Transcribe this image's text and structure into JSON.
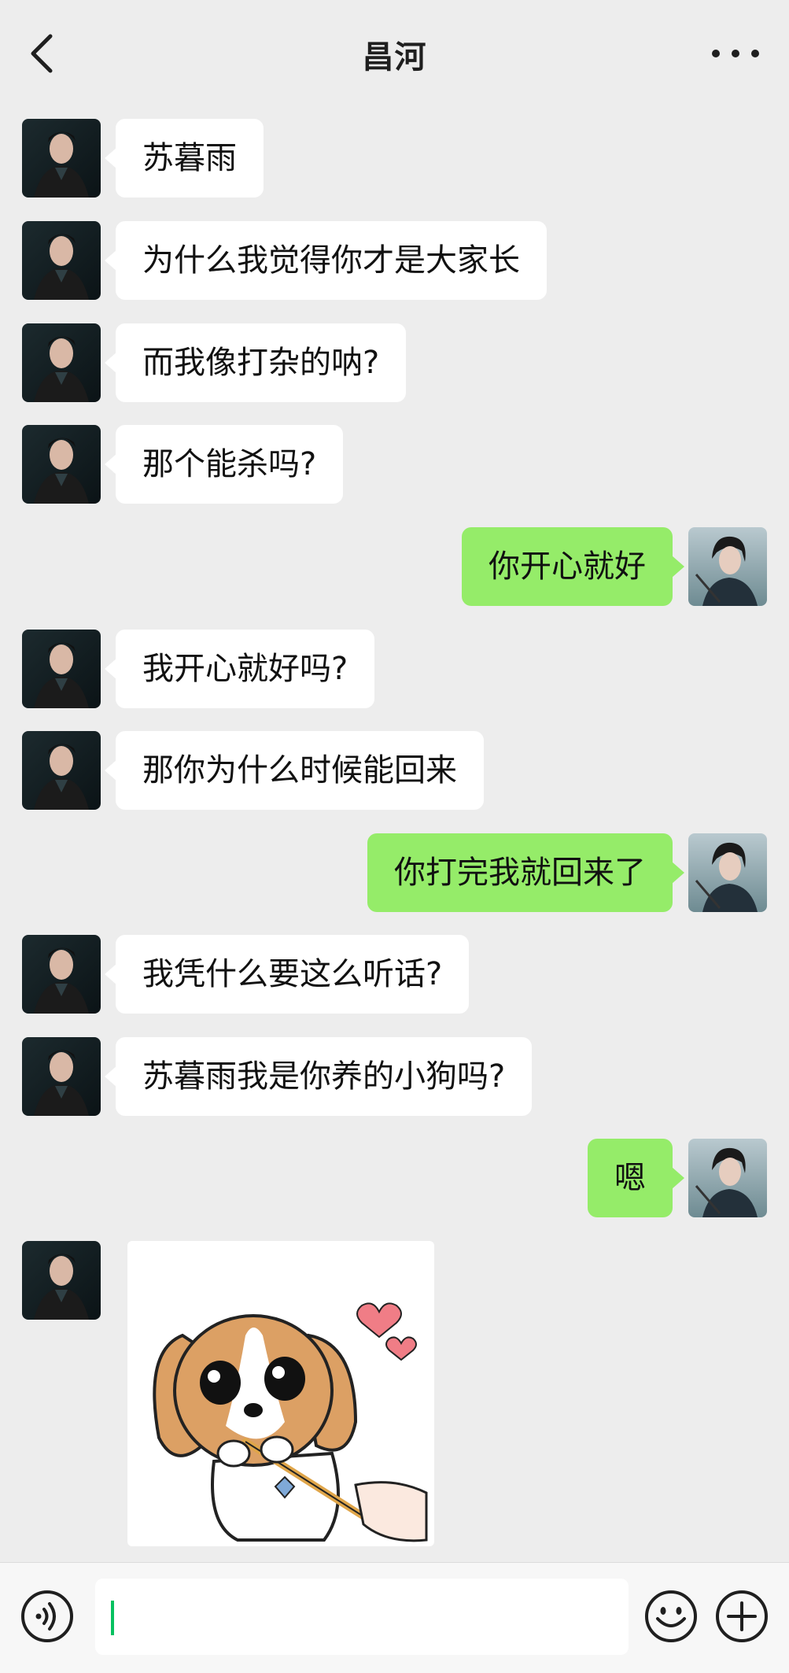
{
  "header": {
    "title": "昌河",
    "back_icon": "chevron-left-icon",
    "more_icon": "more-dots-icon"
  },
  "messages": [
    {
      "side": "in",
      "text": "苏暮雨"
    },
    {
      "side": "in",
      "text": "为什么我觉得你才是大家长"
    },
    {
      "side": "in",
      "text": "而我像打杂的呐?"
    },
    {
      "side": "in",
      "text": "那个能杀吗?"
    },
    {
      "side": "out",
      "text": "你开心就好"
    },
    {
      "side": "in",
      "text": "我开心就好吗?"
    },
    {
      "side": "in",
      "text": "那你为什么时候能回来"
    },
    {
      "side": "out",
      "text": "你打完我就回来了"
    },
    {
      "side": "in",
      "text": "我凭什么要这么听话?"
    },
    {
      "side": "in",
      "text": "苏暮雨我是你养的小狗吗?"
    },
    {
      "side": "out",
      "text": "嗯"
    },
    {
      "side": "in",
      "type": "sticker",
      "sticker": "puppy-with-hearts-sticker"
    }
  ],
  "footer": {
    "voice_icon": "voice-icon",
    "input_value": "",
    "emoji_icon": "emoji-icon",
    "plus_icon": "plus-icon"
  },
  "colors": {
    "background": "#ededed",
    "outgoing_bubble": "#95ec69",
    "incoming_bubble": "#ffffff",
    "caret": "#07c160"
  }
}
